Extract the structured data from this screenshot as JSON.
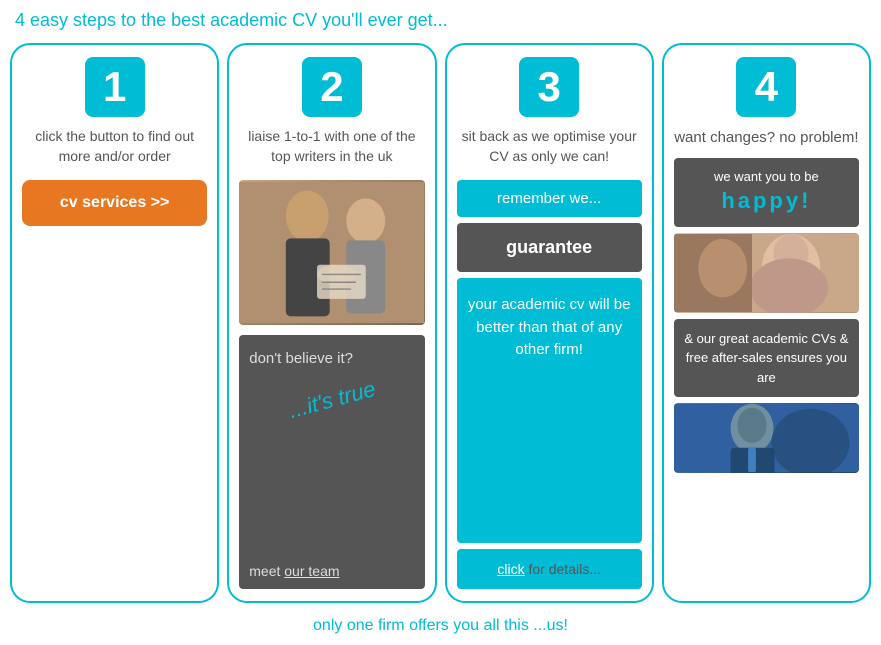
{
  "page": {
    "title": "4 easy steps to the best academic CV you'll ever get...",
    "footer": "only one firm offers you all this ...us!"
  },
  "column1": {
    "step": "1",
    "description": "click the button to find out more and/or order",
    "button_label": "cv services >>"
  },
  "column2": {
    "step": "2",
    "description": "liaise 1-to-1 with one of the top writers in the uk",
    "dont_believe": "don't believe it?",
    "its_true": "...it's true",
    "meet_team_prefix": "meet ",
    "meet_team_link": "our team"
  },
  "column3": {
    "step": "3",
    "description": "sit back as we optimise your CV as only we can!",
    "remember": "remember we...",
    "guarantee": "guarantee",
    "academic_cv": "your academic cv will be better than that of any other firm!",
    "click_label": "click",
    "click_suffix": " for details..."
  },
  "column4": {
    "step": "4",
    "description": "want changes? no problem!",
    "happy_prefix": "we want you to be",
    "happy_word": "happy!",
    "great_cvs": "& our great academic CVs & free after-sales ensures you are"
  }
}
